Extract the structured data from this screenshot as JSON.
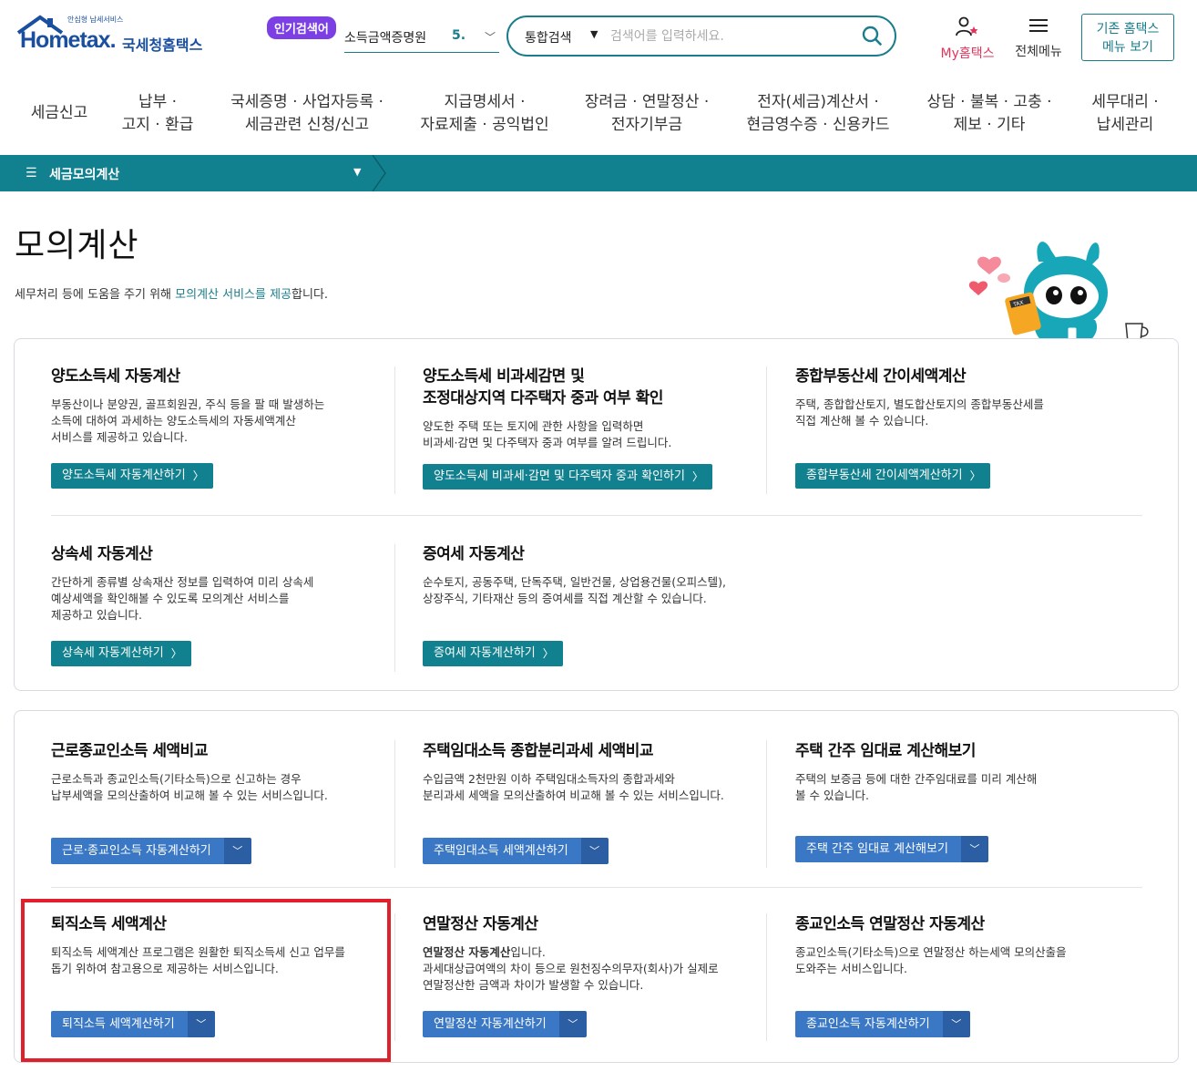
{
  "header": {
    "logo_small": "안심형 납세서비스",
    "logo_main": "Hometax.",
    "logo_text": "국세청홈택스",
    "popular_badge": "인기검색어",
    "popular_term": "소득금액증명원",
    "popular_rank": "5.",
    "search_scope": "통합검색",
    "search_placeholder": "검색어를 입력하세요.",
    "my_hometax": "My홈택스",
    "all_menu": "전체메뉴",
    "old_menu": "기존 홈택스\n메뉴 보기"
  },
  "nav": [
    "세금신고",
    "납부 ·\n고지 · 환급",
    "국세증명 · 사업자등록 ·\n세금관련 신청/신고",
    "지급명세서 ·\n자료제출 · 공익법인",
    "장려금 · 연말정산 ·\n전자기부금",
    "전자(세금)계산서 ·\n현금영수증 · 신용카드",
    "상담 · 불복 · 고충 ·\n제보 · 기타",
    "세무대리 ·\n납세관리"
  ],
  "breadcrumb": {
    "label": "세금모의계산"
  },
  "page": {
    "title": "모의계산",
    "subtitle_pre": "세무처리 등에 도움을 주기 위해 ",
    "subtitle_hl": "모의계산 서비스를 제공",
    "subtitle_post": "합니다."
  },
  "panel1": [
    {
      "title": "양도소득세 자동계산",
      "desc": "부동산이나 분양권, 골프회원권, 주식 등을 팔 때 발생하는\n소득에 대하여 과세하는 양도소득세의 자동세액계산\n서비스를 제공하고 있습니다.",
      "button": "양도소득세 자동계산하기"
    },
    {
      "title": "양도소득세 비과세감면 및\n조정대상지역 다주택자 중과 여부 확인",
      "desc": "양도한 주택 또는 토지에 관한 사항을 입력하면\n비과세·감면 및 다주택자 중과 여부를 알려 드립니다.",
      "button": "양도소득세 비과세·감면 및 다주택자 중과 확인하기"
    },
    {
      "title": "종합부동산세 간이세액계산",
      "desc": "주택, 종합합산토지, 별도합산토지의 종합부동산세를\n직접 계산해 볼 수 있습니다.",
      "button": "종합부동산세 간이세액계산하기"
    },
    {
      "title": "상속세 자동계산",
      "desc": "간단하게 종류별 상속재산 정보를 입력하여 미리 상속세\n예상세액을 확인해볼 수 있도록 모의계산 서비스를\n제공하고 있습니다.",
      "button": "상속세 자동계산하기"
    },
    {
      "title": "증여세 자동계산",
      "desc": "순수토지, 공동주택, 단독주택, 일반건물, 상업용건물(오피스텔),\n상장주식, 기타재산 등의 증여세를 직접 계산할 수 있습니다.",
      "button": "증여세 자동계산하기"
    }
  ],
  "panel2": [
    {
      "title": "근로종교인소득 세액비교",
      "desc": "근로소득과 종교인소득(기타소득)으로 신고하는 경우\n납부세액을 모의산출하여 비교해 볼 수 있는 서비스입니다.",
      "button": "근로·종교인소득 자동계산하기"
    },
    {
      "title": "주택임대소득 종합분리과세 세액비교",
      "desc": "수입금액 2천만원 이하 주택임대소득자의 종합과세와\n분리과세 세액을 모의산출하여 비교해 볼 수 있는 서비스입니다.",
      "button": "주택임대소득 세액계산하기"
    },
    {
      "title": "주택 간주 임대료 계산해보기",
      "desc": "주택의 보증금 등에 대한 간주임대료를 미리 계산해\n볼 수 있습니다.",
      "button": "주택 간주 임대료 계산해보기"
    },
    {
      "title": "퇴직소득 세액계산",
      "desc": "퇴직소득 세액계산 프로그램은 원활한 퇴직소득세 신고 업무를\n돕기 위하여 참고용으로 제공하는 서비스입니다.",
      "button": "퇴직소득 세액계산하기"
    },
    {
      "title": "연말정산 자동계산",
      "desc_bold": "연말정산 자동계산",
      "desc_after_bold": "입니다.",
      "desc": "과세대상급여액의 차이 등으로 원천징수의무자(회사)가 실제로\n연말정산한 금액과 차이가 발생할 수 있습니다.",
      "button": "연말정산 자동계산하기"
    },
    {
      "title": "종교인소득 연말정산 자동계산",
      "desc": "종교인소득(기타소득)으로 연말정산 하는세액 모의산출을\n도와주는 서비스입니다.",
      "button": "종교인소득 자동계산하기"
    }
  ],
  "mascot_tag": "TAX",
  "colors": {
    "teal": "#12818f",
    "blue": "#3a78c6",
    "highlight": "#e0202a",
    "badge": "#7b3fe4"
  }
}
